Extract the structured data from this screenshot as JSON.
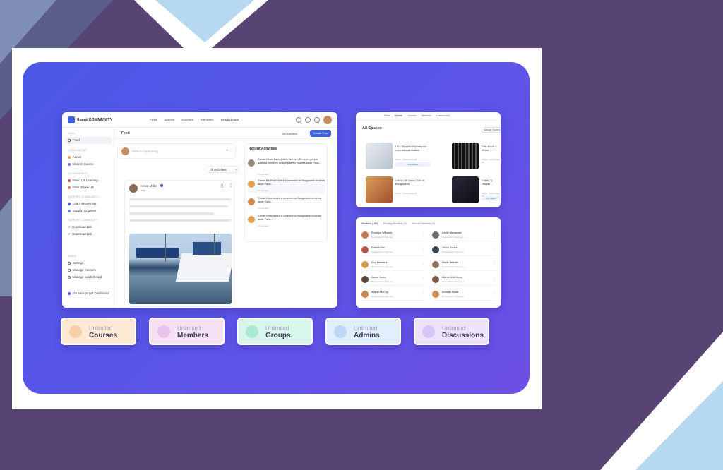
{
  "app": {
    "brand": "fluent COMMUNITY",
    "nav": [
      "Feed",
      "Spaces",
      "Courses",
      "Members",
      "Leaderboard"
    ],
    "page_title": "Feed",
    "filter_label": "All Activities",
    "create_post_label": "Create Post",
    "composer_placeholder": "What's happening",
    "all_activities_label": "All Activities",
    "post_author": "Kevin Miller",
    "post_time": "2nd",
    "sidebar": {
      "sections": [
        {
          "heading": "MAIN",
          "items": [
            "Feed"
          ]
        },
        {
          "heading": "COMMUNITIES",
          "items": [
            "Admin",
            "Modern Course"
          ]
        },
        {
          "heading": "UI COMMUNITY",
          "items": [
            "Basic UX Learning",
            "Data Driven UX"
          ]
        },
        {
          "heading": "SUPPORT COMMUNITY",
          "items": [
            "Learn WordPress",
            "Support Engineer"
          ]
        },
        {
          "heading": "SUPPORT COMMUNITY",
          "items": [
            "Download Link",
            "Download Link"
          ]
        },
        {
          "heading": "ADMIN",
          "items": [
            "Settings",
            "Manage Courses",
            "Manage Leaderboard"
          ]
        }
      ],
      "footer": "Go Back to WP Dashboard"
    },
    "recent_activities": {
      "title": "Recent Activities",
      "items": [
        {
          "text": "Rahabi Khan, Kamrul John Doe and 32 others people added a comment on Bangladesh brushes aside Pakis...",
          "time": "2 hours ago"
        },
        {
          "text": "Zawad Bin Khalil added a comment on Bangladesh brushes aside Pakis...",
          "time": "2 hours ago"
        },
        {
          "text": "Rahabi Khan added a comment on Bangladesh brushes aside Pakis...",
          "time": "2 hours ago"
        },
        {
          "text": "Rahabi Khan added a comment on Bangladesh brushes aside Pakis...",
          "time": "2 hours ago"
        }
      ]
    }
  },
  "spaces": {
    "nav": [
      "Feed",
      "Spaces",
      "Courses",
      "Members",
      "Leaderboard"
    ],
    "title": "All Spaces",
    "manage_label": "Manage Spaces",
    "items": [
      {
        "title": "USA Student Visa help for international student",
        "meta": "Public · Joined Sep 18",
        "button": "Join Space",
        "color": "#d8dde4"
      },
      {
        "title": "Dirty Black & White",
        "meta": "Public · Joined Sep 18",
        "button": "",
        "color": "#222"
      },
      {
        "title": "Life in UK Users Club of Bangladesh",
        "meta": "Public · Joined Sep 18",
        "button": "",
        "color": "#c8653a"
      },
      {
        "title": "Cyber 71 Hacker",
        "meta": "Public · Joined Sep 18",
        "button": "Join Space",
        "color": "#1c1c26"
      }
    ]
  },
  "members": {
    "tabs": [
      "Members (199)",
      "Pending Members (0)",
      "Blocked Members (0)"
    ],
    "items": [
      {
        "name": "Emarlyn Williams",
        "sub": "Responded 4 days ago",
        "color": "#c47a55"
      },
      {
        "name": "Leslie Alexander",
        "sub": "Responded 4 days ago",
        "color": "#6d6a66"
      },
      {
        "name": "Robert Fox",
        "sub": "Responded 4 days ago",
        "color": "#b55a4a"
      },
      {
        "name": "Jacob Jones",
        "sub": "Responded 4 days ago",
        "color": "#3b4658"
      },
      {
        "name": "Guy Hawkins",
        "sub": "Responded 4 days ago",
        "color": "#d49a4a"
      },
      {
        "name": "Wade Warren",
        "sub": "Responded 4 days ago",
        "color": "#8a6d5a"
      },
      {
        "name": "Jacob Jones",
        "sub": "Responded 4 days ago",
        "color": "#5a4a3e"
      },
      {
        "name": "Marvin McKinney",
        "sub": "Responded 4 days ago",
        "color": "#7a5a4a"
      },
      {
        "name": "Arlene McCoy",
        "sub": "Responded 4 days ago",
        "color": "#c7864c"
      },
      {
        "name": "Annette Black",
        "sub": "Responded 4 days ago",
        "color": "#d1884b"
      }
    ]
  },
  "features": [
    {
      "line1": "Unlimited",
      "line2": "Courses",
      "bg": "#fde9d6",
      "icon": "course-icon",
      "icon_bg": "#f7cfa6"
    },
    {
      "line1": "Unlimited",
      "line2": "Members",
      "bg": "#f6e1f4",
      "icon": "member-icon",
      "icon_bg": "#eac1e8"
    },
    {
      "line1": "Unlimited",
      "line2": "Groups",
      "bg": "#d8f6ec",
      "icon": "group-icon",
      "icon_bg": "#a9ead4"
    },
    {
      "line1": "Unlimited",
      "line2": "Admins",
      "bg": "#e1eefc",
      "icon": "admin-icon",
      "icon_bg": "#bcd6f5"
    },
    {
      "line1": "Unlimited",
      "line2": "Discussions",
      "bg": "#ece3fb",
      "icon": "discussion-icon",
      "icon_bg": "#d6c5f6"
    }
  ]
}
